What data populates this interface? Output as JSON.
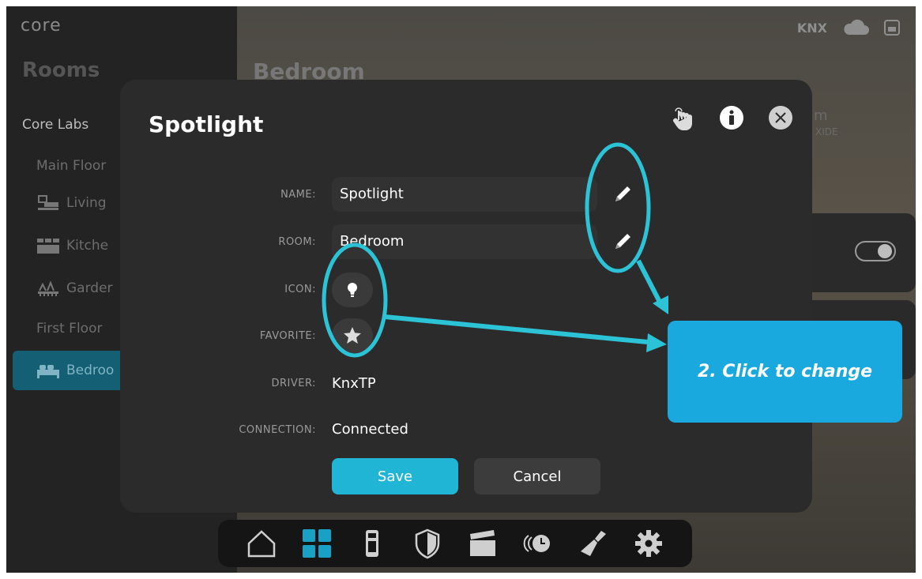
{
  "app": {
    "logo": "core",
    "connection_label": "KNX"
  },
  "sidebar": {
    "title": "Rooms",
    "building": "Core Labs",
    "floors": [
      {
        "label": "Main Floor"
      },
      {
        "label": "First Floor"
      }
    ],
    "rooms": [
      {
        "label": "Living",
        "icon": "sofa-tv-icon"
      },
      {
        "label": "Kitche",
        "icon": "kitchen-icon"
      },
      {
        "label": "Garder",
        "icon": "garden-icon"
      },
      {
        "label": "Bedroo",
        "icon": "bed-icon",
        "selected": true
      }
    ]
  },
  "main": {
    "title": "Bedroom",
    "partial_text_1": "m",
    "partial_text_2": "XIDE"
  },
  "dialog": {
    "title": "Spotlight",
    "fields": {
      "name_label": "NAME:",
      "name_value": "Spotlight",
      "room_label": "ROOM:",
      "room_value": "Bedroom",
      "icon_label": "ICON:",
      "favorite_label": "FAVORITE:",
      "driver_label": "DRIVER:",
      "driver_value": "KnxTP",
      "connection_label": "CONNECTION:",
      "connection_value": "Connected"
    },
    "save_label": "Save",
    "cancel_label": "Cancel"
  },
  "bottom_nav": {
    "items": [
      {
        "icon": "home-icon"
      },
      {
        "icon": "grid-icon",
        "active": true
      },
      {
        "icon": "keypad-icon"
      },
      {
        "icon": "shield-icon"
      },
      {
        "icon": "clapperboard-icon"
      },
      {
        "icon": "schedule-icon"
      },
      {
        "icon": "cleaning-icon"
      },
      {
        "icon": "gear-icon"
      }
    ]
  },
  "annotation": {
    "callout_text": "2. Click to change",
    "color": "#2cc3d6"
  },
  "colors": {
    "accent": "#20b5d4",
    "selected_room": "#145f74",
    "dialog_bg": "#2b2b2b",
    "callout_bg": "#1aa9df"
  }
}
